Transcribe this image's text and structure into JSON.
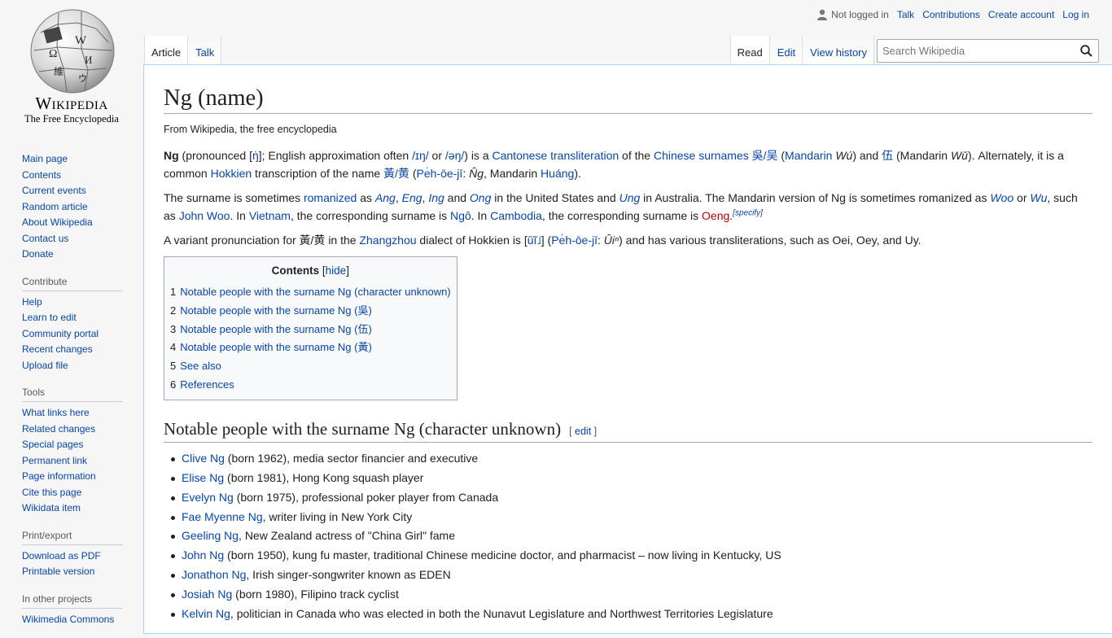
{
  "logo": {
    "wordmark": "Wikipedia",
    "tagline": "The Free Encyclopedia"
  },
  "personal": {
    "not_logged": "Not logged in",
    "talk": "Talk",
    "contributions": "Contributions",
    "create_account": "Create account",
    "login": "Log in"
  },
  "tabs": {
    "article": "Article",
    "talk": "Talk",
    "read": "Read",
    "edit": "Edit",
    "history": "View history"
  },
  "search": {
    "placeholder": "Search Wikipedia"
  },
  "sidebar": {
    "nav": [
      "Main page",
      "Contents",
      "Current events",
      "Random article",
      "About Wikipedia",
      "Contact us",
      "Donate"
    ],
    "contribute_title": "Contribute",
    "contribute": [
      "Help",
      "Learn to edit",
      "Community portal",
      "Recent changes",
      "Upload file"
    ],
    "tools_title": "Tools",
    "tools": [
      "What links here",
      "Related changes",
      "Special pages",
      "Permanent link",
      "Page information",
      "Cite this page",
      "Wikidata item"
    ],
    "print_title": "Print/export",
    "print": [
      "Download as PDF",
      "Printable version"
    ],
    "projects_title": "In other projects",
    "projects": [
      "Wikimedia Commons"
    ]
  },
  "article": {
    "title": "Ng (name)",
    "site_sub": "From Wikipedia, the free encyclopedia",
    "p1": {
      "ng": "Ng",
      "t1": " (pronounced [",
      "ipa1": "ŋ̍",
      "t2": "]; English approximation often ",
      "ipa2": "/ɪŋ/",
      "t3": " or ",
      "ipa3": "/əŋ/",
      "t4": ") is a ",
      "l1": "Cantonese transliteration",
      "t5": " of the ",
      "l2": "Chinese surnames",
      "t6": " ",
      "l3": "吳/吴",
      "t7": " (",
      "l4": "Mandarin",
      "t8": " ",
      "wu1": "Wú",
      "t9": ") and ",
      "l5": "伍",
      "t10": " (Mandarin ",
      "wu2": "Wǔ",
      "t11": "). Alternately, it is a common ",
      "l6": "Hokkien",
      "t12": " transcription of the name ",
      "l7": "黃/黄",
      "t13": " (",
      "l8": "Pe̍h-ōe-jī",
      "t14": ": ",
      "ng2": "N̂g",
      "t15": ", Mandarin ",
      "l9": "Huáng",
      "t16": ")."
    },
    "p2": {
      "t1": "The surname is sometimes ",
      "l1": "romanized",
      "t2": " as ",
      "l2": "Ang",
      "t3": ", ",
      "l3": "Eng",
      "t4": ", ",
      "l4": "Ing",
      "t5": " and ",
      "l5": "Ong",
      "t6": " in the United States and ",
      "l6": "Ung",
      "t7": " in Australia. The Mandarin version of Ng is sometimes romanized as ",
      "l7": "Woo",
      "t8": " or ",
      "l8": "Wu",
      "t9": ", such as ",
      "l9": "John Woo",
      "t10": ". In ",
      "l10": "Vietnam",
      "t11": ", the corresponding surname is ",
      "l11": "Ngô",
      "t12": ". In ",
      "l12": "Cambodia",
      "t13": ", the corresponding surname is ",
      "l13": "Oeng",
      "t14": ".",
      "sup": "[specify]"
    },
    "p3": {
      "t1": "A variant pronunciation for 黃/黄 in the ",
      "l1": "Zhangzhou",
      "t2": " dialect of Hokkien is [",
      "l2": "ŭĩ˩",
      "t3": "] (",
      "l3": "Pe̍h-ōe-jī",
      "t4": ": ",
      "ui": "Ûiⁿ",
      "t5": ") and has various transliterations, such as Oei, Oey, and Uy."
    },
    "toc": {
      "title": "Contents",
      "open": " [",
      "hide": "hide",
      "close": "]",
      "items": [
        {
          "num": "1",
          "text": "Notable people with the surname Ng (character unknown)"
        },
        {
          "num": "2",
          "text": "Notable people with the surname Ng (吳)"
        },
        {
          "num": "3",
          "text": "Notable people with the surname Ng (伍)"
        },
        {
          "num": "4",
          "text": "Notable people with the surname Ng (黃)"
        },
        {
          "num": "5",
          "text": "See also"
        },
        {
          "num": "6",
          "text": "References"
        }
      ]
    },
    "section1": {
      "title": "Notable people with the surname Ng (character unknown)",
      "edit_open": "[ ",
      "edit": "edit",
      "edit_close": " ]"
    },
    "people": [
      {
        "name": "Clive Ng",
        "desc": " (born 1962), media sector financier and executive"
      },
      {
        "name": "Elise Ng",
        "desc": " (born 1981), Hong Kong squash player"
      },
      {
        "name": "Evelyn Ng",
        "desc": " (born 1975), professional poker player from Canada"
      },
      {
        "name": "Fae Myenne Ng",
        "desc": ", writer living in New York City"
      },
      {
        "name": "Geeling Ng",
        "desc": ", New Zealand actress of \"China Girl\" fame"
      },
      {
        "name": "John Ng",
        "desc": " (born 1950), kung fu master, traditional Chinese medicine doctor, and pharmacist – now living in Kentucky, US"
      },
      {
        "name": "Jonathon Ng",
        "desc": ", Irish singer-songwriter known as EDEN"
      },
      {
        "name": "Josiah Ng",
        "desc": " (born 1980), Filipino track cyclist"
      },
      {
        "name": "Kelvin Ng",
        "desc": ", politician in Canada who was elected in both the Nunavut Legislature and Northwest Territories Legislature"
      }
    ]
  }
}
